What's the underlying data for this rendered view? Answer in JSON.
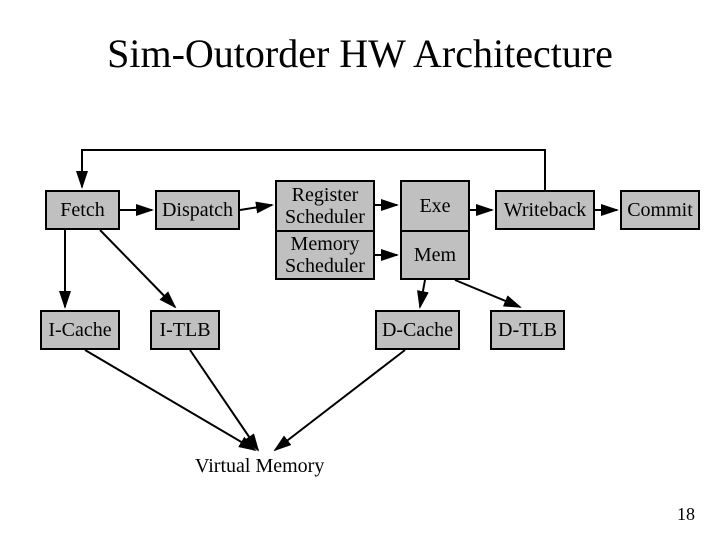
{
  "title": "Sim-Outorder HW Architecture",
  "pipeline": {
    "fetch": "Fetch",
    "dispatch": "Dispatch",
    "reg_scheduler": "Register Scheduler",
    "mem_scheduler": "Memory Scheduler",
    "exe": "Exe",
    "mem": "Mem",
    "writeback": "Writeback",
    "commit": "Commit"
  },
  "caches": {
    "icache": "I-Cache",
    "itlb": "I-TLB",
    "dcache": "D-Cache",
    "dtlb": "D-TLB"
  },
  "virtual_memory_label": "Virtual Memory",
  "page_number": "18"
}
